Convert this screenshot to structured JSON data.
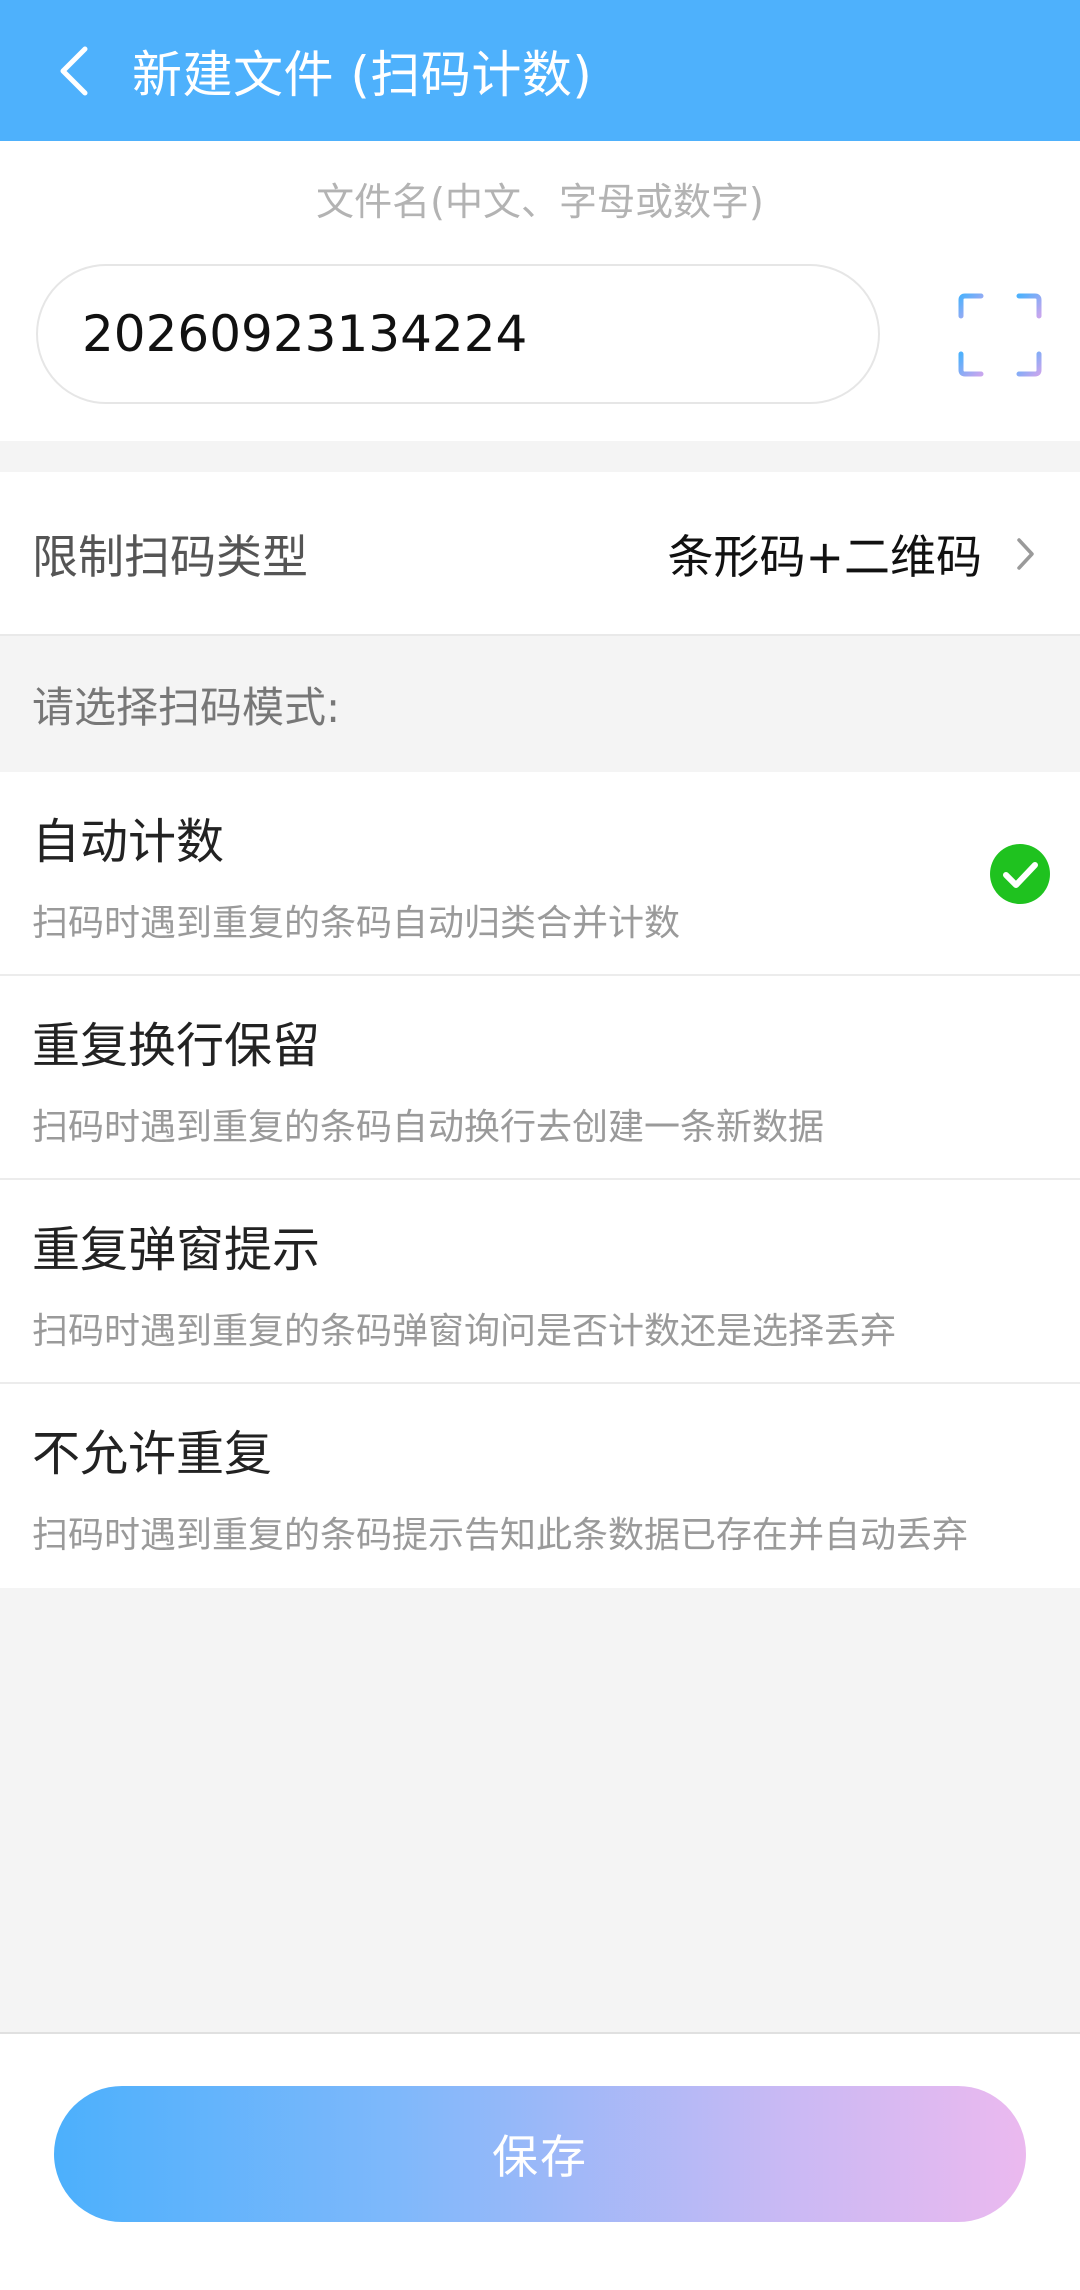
{
  "header": {
    "title": "新建文件 (扫码计数)",
    "back_icon": "chevron-left-icon"
  },
  "filename": {
    "hint": "文件名(中文、字母或数字)",
    "value": "20260923134224",
    "scan_icon": "scan-frame-icon"
  },
  "scan_type": {
    "label": "限制扫码类型",
    "value": "条形码+二维码"
  },
  "mode_section": {
    "header": "请选择扫码模式:",
    "selected_index": 0,
    "options": [
      {
        "title": "自动计数",
        "desc": "扫码时遇到重复的条码自动归类合并计数",
        "selected": true
      },
      {
        "title": "重复换行保留",
        "desc": "扫码时遇到重复的条码自动换行去创建一条新数据",
        "selected": false
      },
      {
        "title": "重复弹窗提示",
        "desc": "扫码时遇到重复的条码弹窗询问是否计数还是选择丢弃",
        "selected": false
      },
      {
        "title": "不允许重复",
        "desc": "扫码时遇到重复的条码提示告知此条数据已存在并自动丢弃",
        "selected": false
      }
    ]
  },
  "footer": {
    "save_label": "保存"
  },
  "colors": {
    "header_bg": "#4eb1fc",
    "check_green": "#1fc21f",
    "save_gradient_start": "#4cb0fc",
    "save_gradient_end": "#ebb9ef"
  }
}
